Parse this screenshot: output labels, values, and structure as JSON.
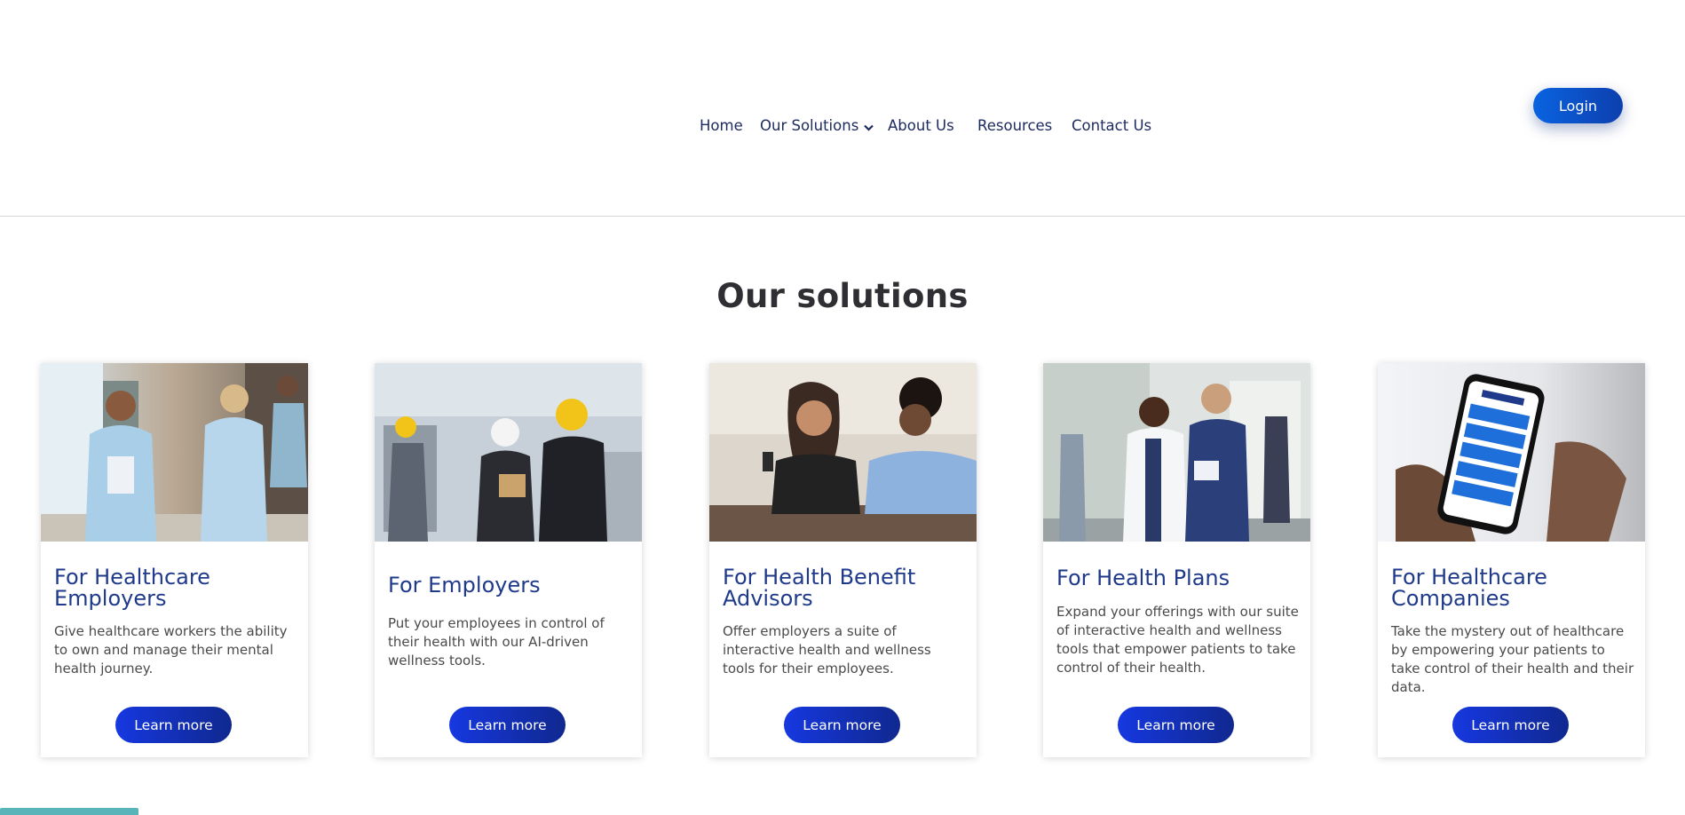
{
  "nav": {
    "items": [
      {
        "label": "Home"
      },
      {
        "label": "Our Solutions"
      },
      {
        "label": "About Us"
      },
      {
        "label": "Resources"
      },
      {
        "label": "Contact Us"
      }
    ],
    "login_label": "Login"
  },
  "main": {
    "title": "Our solutions",
    "cards": [
      {
        "title": "For Healthcare Employers",
        "description": "Give healthcare workers the ability to own and manage their mental health journey.",
        "button": "Learn more",
        "image": "nurses-walking-photo"
      },
      {
        "title": "For Employers",
        "description": "Put your employees in control of their health with our AI-driven wellness tools.",
        "button": "Learn more",
        "image": "factory-workers-hardhats-photo"
      },
      {
        "title": "For Health Benefit Advisors",
        "description": "Offer employers a suite of interactive health and wellness tools for their employees.",
        "button": "Learn more",
        "image": "advisor-meeting-phone-photo"
      },
      {
        "title": "For Health Plans",
        "description": "Expand your offerings with our suite of interactive health and wellness tools that empower patients to take control of their health.",
        "button": "Learn more",
        "image": "doctors-hallway-photo"
      },
      {
        "title": "For Healthcare Companies",
        "description": "Take the mystery out of healthcare by empowering your patients to take control of their health and their data.",
        "button": "Learn more",
        "image": "phone-app-in-hands-photo"
      }
    ]
  },
  "colors": {
    "nav_text": "#1c2a5e",
    "card_title": "#1f3a8a",
    "button_blue": "#1638e0",
    "login_blue": "#0a63e0"
  }
}
